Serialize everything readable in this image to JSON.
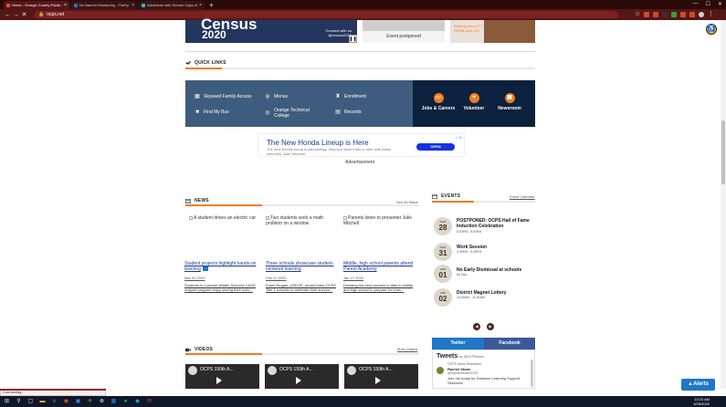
{
  "browser": {
    "tabs": [
      {
        "label": "Home - Orange County Public Sc",
        "active": true
      },
      {
        "label": "No Banner Monitoring - FireEy",
        "active": false
      },
      {
        "label": "Adventure with Screen Caps of",
        "active": false
      }
    ],
    "new_tab": "+",
    "url": "ocps.net",
    "window_controls": {
      "minimize": "—",
      "maximize": "☐",
      "close": "✕"
    }
  },
  "hero": {
    "census_line1": "Census",
    "census_line2": "2020",
    "connect": "Connect with us",
    "connect_sub": "@census2020",
    "event_postponed": "Event postponed",
    "right_text1": "Starting March 27",
    "right_text2": "GRAB AND GO"
  },
  "quick_links": {
    "title": "QUICK LINKS",
    "items": [
      {
        "label": "Skyward Family Access",
        "icon": "grid-icon"
      },
      {
        "label": "Menus",
        "icon": "utensils-icon"
      },
      {
        "label": "Enrollment",
        "icon": "trophy-icon"
      },
      {
        "label": "Find My Bus",
        "icon": "bus-icon"
      },
      {
        "label": "Orange Technical College",
        "icon": "compass-icon"
      },
      {
        "label": "Records",
        "icon": "document-icon"
      }
    ],
    "featured": [
      {
        "label": "Jobs & Careers",
        "icon": "briefcase-icon"
      },
      {
        "label": "Volunteer",
        "icon": "heart-icon"
      },
      {
        "label": "Newsroom",
        "icon": "newspaper-icon"
      }
    ]
  },
  "ad": {
    "headline": "The New Honda Lineup is Here",
    "body": "The new Honda lineup is astonishing. Discover what it has to offer with these searches. Auto Informer",
    "cta": "OPEN",
    "adchoices": "▷✕",
    "label": "Advertisement"
  },
  "news": {
    "title": "NEWS",
    "see_all": "See All News",
    "items": [
      {
        "img_alt": "A student drives an electric car",
        "headline": "Student projects highlight hands-on learning",
        "date": "Mar 05 2020",
        "snippet": "Students in Lockhart Middle School's CAGE magnet program enjoy seeing their scho..."
      },
      {
        "img_alt": "Two students work a math problem on a window",
        "headline": "Three schools showcase student-centered learning",
        "date": "Feb 21 2020",
        "snippet": "Frank Brogan, USDOE, toured three OCPS Title 1 schools to celebrate their succes..."
      },
      {
        "img_alt": "Parents listen to presenter Julie Mitchell",
        "headline": "Middle, high school parents attend Parent Academy",
        "date": "Jan 27 2020",
        "snippet": "Deciding the best courses to take in middle and high school to prepare for ones..."
      }
    ]
  },
  "events": {
    "title": "EVENTS",
    "calendar_link": "Event Calendar",
    "items": [
      {
        "month": "MAR",
        "day": "28",
        "title": "POSTPONED: OCPS Hall of Fame Induction Celebration",
        "time": "5:00PM - 9:00PM"
      },
      {
        "month": "MAR",
        "day": "31",
        "title": "Work Session",
        "time": "4:30PM - 5:30PM"
      },
      {
        "month": "APR",
        "day": "01",
        "title": "No Early Dismissal at schools",
        "time": "All Day"
      },
      {
        "month": "APR",
        "day": "02",
        "title": "District Magnet Lottery",
        "time": "10:00AM - 11:00AM"
      }
    ],
    "prev": "◀",
    "next": "▶"
  },
  "social": {
    "twitter_tab": "Twitter",
    "facebook_tab": "Facebook",
    "tweets_header": "Tweets",
    "tweets_by": "by @OCPSnews",
    "retweeted": "OCPS News Retweeted",
    "author_name": "Rachel Stone",
    "author_handle": "@RachelStoneOCPS",
    "tweet_body": "Join me today for Distance Learning Support Sessions!"
  },
  "videos": {
    "title": "VIDEOS",
    "more": "More Videos",
    "items": [
      {
        "title": "OCPS 150th A..."
      },
      {
        "title": "OCPS 150th A..."
      },
      {
        "title": "OCPS 150th A..."
      }
    ]
  },
  "alerts_label": "Alerts",
  "status_text": "Connecting...",
  "clock": {
    "time": "10:23 AM",
    "date": "3/25/2020"
  },
  "colors": {
    "accent": "#f07c22",
    "navy": "#0b213d",
    "quicklink_blue": "#3e5c7d",
    "twitter": "#1e77c8",
    "facebook": "#3b5998"
  }
}
